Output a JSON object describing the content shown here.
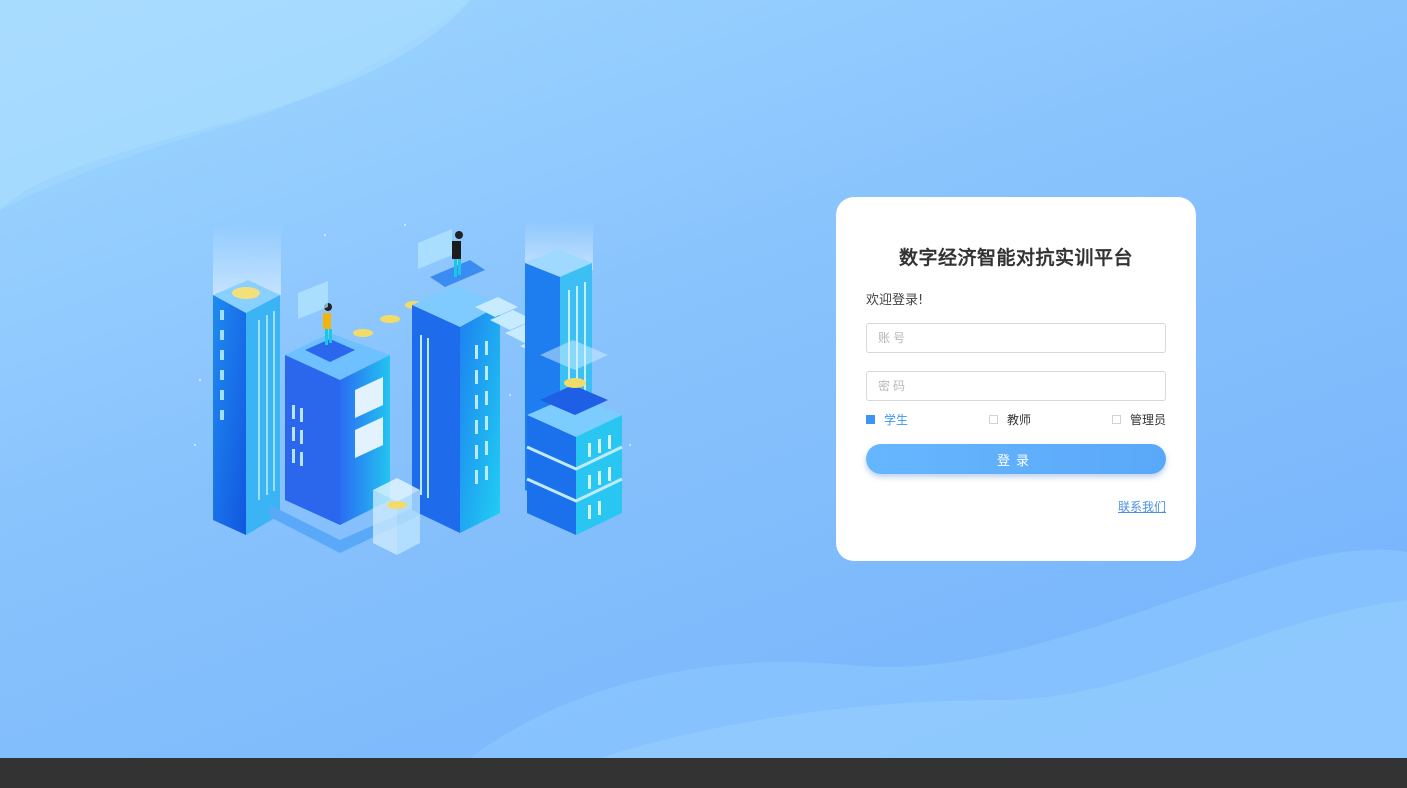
{
  "login": {
    "title": "数字经济智能对抗实训平台",
    "welcome": "欢迎登录!",
    "account_placeholder": "账号",
    "password_placeholder": "密码",
    "roles": [
      {
        "label": "学生",
        "checked": true
      },
      {
        "label": "教师",
        "checked": false
      },
      {
        "label": "管理员",
        "checked": false
      }
    ],
    "submit_label": "登录",
    "contact_label": "联系我们"
  },
  "colors": {
    "accent": "#3b95f5",
    "button": "#5aa8f9",
    "background_top": "#9fd8ff",
    "background_bottom": "#74b1fb",
    "footer": "#333333"
  },
  "icons": {
    "illustration": "isometric-city-illustration"
  }
}
